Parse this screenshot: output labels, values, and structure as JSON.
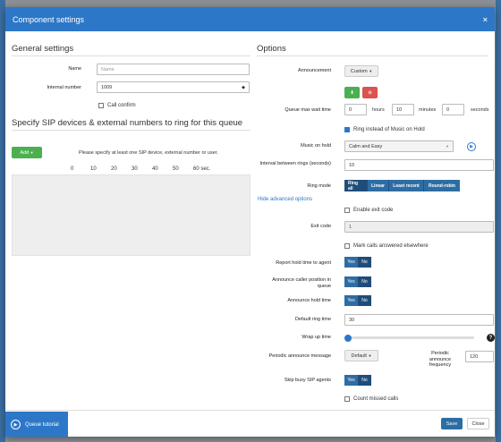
{
  "header": {
    "title": "Component settings",
    "close": "×"
  },
  "general": {
    "heading": "General settings",
    "name_label": "Name",
    "name_placeholder": "Name",
    "number_label": "Internal number",
    "number_value": "1009",
    "call_confirm": "Call confirm"
  },
  "sip": {
    "heading": "Specify SIP devices & external numbers to ring for this queue",
    "add_label": "Add",
    "hint": "Please specify at least one SIP device, external number or user.",
    "ticks": [
      "0",
      "10",
      "20",
      "30",
      "40",
      "50",
      "60 sec."
    ]
  },
  "options": {
    "heading": "Options",
    "announcement_label": "Announcement",
    "announcement_value": "Custom",
    "max_wait_label": "Queue max wait time",
    "hours_value": "0",
    "hours_label": "hours",
    "minutes_value": "10",
    "minutes_label": "minutes",
    "seconds_value": "0",
    "seconds_label": "seconds",
    "ring_instead": "Ring instead of Music on Hold",
    "music_label": "Music on hold",
    "music_value": "Calm and Easy",
    "interval_label": "Interval between rings (seconds)",
    "interval_value": "10",
    "ring_mode_label": "Ring mode",
    "ring_modes": [
      "Ring all",
      "Linear",
      "Least recent",
      "Round-robin"
    ],
    "hide_advanced": "Hide advanced options",
    "enable_exit": "Enable exit code",
    "exit_label": "Exit code",
    "exit_value": "1",
    "mark_calls": "Mark calls answered elsewhere",
    "report_label": "Report hold time to agent",
    "announce_pos_label": "Announce caller position in queue",
    "announce_hold_label": "Announce hold time",
    "default_ring_label": "Default ring time",
    "default_ring_value": "30",
    "wrap_label": "Wrap up time",
    "wrap_value": 0,
    "periodic_label": "Periodic announce message",
    "periodic_value": "Default",
    "frequency_label": "Periodic announce frequency",
    "frequency_value": "120",
    "skip_busy_label": "Skip busy SIP agents",
    "count_missed": "Count missed calls",
    "yes": "Yes",
    "no": "No"
  },
  "footer": {
    "tutorial": "Queue tutorial",
    "save": "Save",
    "close": "Close"
  },
  "colors": {
    "accent": "#2d77c8",
    "segment": "#2e6da4",
    "green": "#4caf50",
    "red": "#d9534f"
  }
}
